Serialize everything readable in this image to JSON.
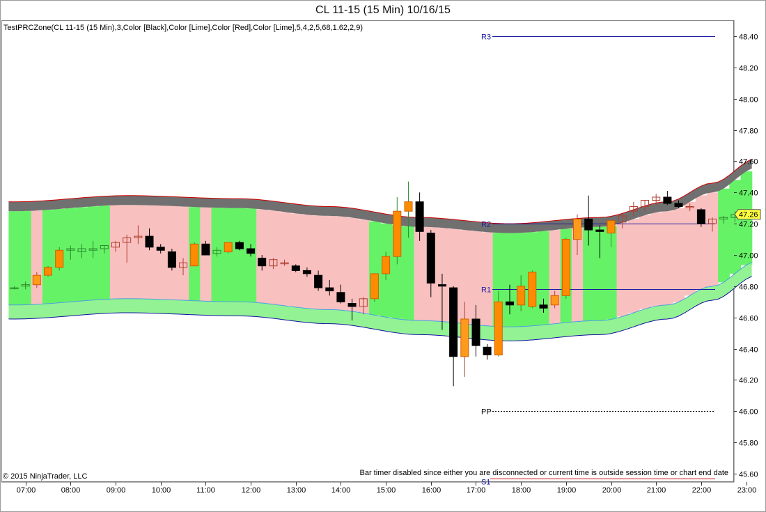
{
  "window": {
    "title": "CL 11-15 (15 Min)  10/16/15"
  },
  "indicator_label": "TestPRCZone(CL 11-15 (15 Min),3,Color [Black],Color [Lime],Color [Red],Color [Lime],5,4,2,5,68,1.62,2,9)",
  "copyright": "© 2015 NinjaTrader, LLC",
  "bar_timer_message": "Bar timer disabled since either you are disconnected or current time is outside session time or chart end date",
  "last_price_label": "47.26",
  "colors": {
    "band_pink": "#f9c0c0",
    "band_green": "#66f266",
    "band_gray": "#707070",
    "lower_band": "#93f293",
    "up_candle": "#ff8c00",
    "down_candle": "#000000",
    "level_line": "#1a1aa0"
  },
  "chart_data": {
    "type": "candlestick",
    "title": "CL 11-15 (15 Min)  10/16/15",
    "instrument": "CL 11-15",
    "interval": "15 Min",
    "date": "10/16/15",
    "x_ticks": [
      "07:00",
      "08:00",
      "09:00",
      "10:00",
      "11:00",
      "12:00",
      "13:00",
      "14:00",
      "15:00",
      "16:00",
      "17:00",
      "18:00",
      "19:00",
      "20:00",
      "21:00",
      "22:00",
      "23:00"
    ],
    "y_ticks": [
      "48.40",
      "48.20",
      "48.00",
      "47.80",
      "47.60",
      "47.40",
      "47.20",
      "47.00",
      "46.80",
      "46.60",
      "46.40",
      "46.20",
      "46.00",
      "45.80",
      "45.60"
    ],
    "ylim": [
      45.58,
      48.48
    ],
    "grid": false,
    "levels": [
      {
        "name": "R3",
        "value": 48.4,
        "style": "solid"
      },
      {
        "name": "R2",
        "value": 47.2,
        "style": "solid"
      },
      {
        "name": "R1",
        "value": 46.78,
        "style": "solid"
      },
      {
        "name": "PP",
        "value": 46.0,
        "style": "dotted"
      },
      {
        "name": "S1",
        "value": 45.57,
        "style": "solid"
      }
    ],
    "last_price": 47.26,
    "candles": [
      {
        "t": "06:45",
        "o": 46.79,
        "h": 46.8,
        "l": 46.78,
        "c": 46.79
      },
      {
        "t": "07:00",
        "o": 46.8,
        "h": 46.83,
        "l": 46.78,
        "c": 46.81
      },
      {
        "t": "07:15",
        "o": 46.81,
        "h": 46.89,
        "l": 46.79,
        "c": 46.87
      },
      {
        "t": "07:30",
        "o": 46.87,
        "h": 46.93,
        "l": 46.86,
        "c": 46.92
      },
      {
        "t": "07:45",
        "o": 46.92,
        "h": 47.05,
        "l": 46.9,
        "c": 47.03
      },
      {
        "t": "08:00",
        "o": 47.03,
        "h": 47.06,
        "l": 46.97,
        "c": 47.04
      },
      {
        "t": "08:15",
        "o": 47.02,
        "h": 47.07,
        "l": 46.98,
        "c": 47.04
      },
      {
        "t": "08:30",
        "o": 47.03,
        "h": 47.09,
        "l": 46.98,
        "c": 47.04
      },
      {
        "t": "08:45",
        "o": 47.04,
        "h": 47.06,
        "l": 47.01,
        "c": 47.06
      },
      {
        "t": "09:00",
        "o": 47.05,
        "h": 47.09,
        "l": 47.02,
        "c": 47.08
      },
      {
        "t": "09:15",
        "o": 47.08,
        "h": 47.13,
        "l": 46.95,
        "c": 47.11
      },
      {
        "t": "09:30",
        "o": 47.11,
        "h": 47.19,
        "l": 47.07,
        "c": 47.12
      },
      {
        "t": "09:45",
        "o": 47.12,
        "h": 47.17,
        "l": 47.03,
        "c": 47.05
      },
      {
        "t": "10:00",
        "o": 47.05,
        "h": 47.07,
        "l": 47.01,
        "c": 47.03
      },
      {
        "t": "10:15",
        "o": 47.02,
        "h": 47.04,
        "l": 46.9,
        "c": 46.92
      },
      {
        "t": "10:30",
        "o": 46.92,
        "h": 46.98,
        "l": 46.87,
        "c": 46.95
      },
      {
        "t": "10:45",
        "o": 46.93,
        "h": 47.08,
        "l": 46.93,
        "c": 47.07
      },
      {
        "t": "11:00",
        "o": 47.07,
        "h": 47.09,
        "l": 47.0,
        "c": 47.0
      },
      {
        "t": "11:15",
        "o": 47.01,
        "h": 47.05,
        "l": 46.99,
        "c": 47.03
      },
      {
        "t": "11:30",
        "o": 47.02,
        "h": 47.08,
        "l": 47.01,
        "c": 47.08
      },
      {
        "t": "11:45",
        "o": 47.08,
        "h": 47.09,
        "l": 47.03,
        "c": 47.04
      },
      {
        "t": "12:00",
        "o": 47.04,
        "h": 47.07,
        "l": 46.99,
        "c": 47.01
      },
      {
        "t": "12:15",
        "o": 46.98,
        "h": 47.0,
        "l": 46.9,
        "c": 46.93
      },
      {
        "t": "12:30",
        "o": 46.93,
        "h": 46.98,
        "l": 46.91,
        "c": 46.97
      },
      {
        "t": "12:45",
        "o": 46.95,
        "h": 46.97,
        "l": 46.93,
        "c": 46.95
      },
      {
        "t": "13:00",
        "o": 46.93,
        "h": 46.94,
        "l": 46.89,
        "c": 46.9
      },
      {
        "t": "13:15",
        "o": 46.9,
        "h": 46.92,
        "l": 46.86,
        "c": 46.88
      },
      {
        "t": "13:30",
        "o": 46.87,
        "h": 46.9,
        "l": 46.77,
        "c": 46.79
      },
      {
        "t": "13:45",
        "o": 46.79,
        "h": 46.84,
        "l": 46.74,
        "c": 46.77
      },
      {
        "t": "14:00",
        "o": 46.76,
        "h": 46.81,
        "l": 46.69,
        "c": 46.7
      },
      {
        "t": "14:15",
        "o": 46.69,
        "h": 46.72,
        "l": 46.58,
        "c": 46.67
      },
      {
        "t": "14:30",
        "o": 46.67,
        "h": 46.73,
        "l": 46.62,
        "c": 46.72
      },
      {
        "t": "14:45",
        "o": 46.72,
        "h": 46.88,
        "l": 46.7,
        "c": 46.88
      },
      {
        "t": "15:00",
        "o": 46.88,
        "h": 47.02,
        "l": 46.84,
        "c": 46.99
      },
      {
        "t": "15:15",
        "o": 46.99,
        "h": 47.37,
        "l": 46.94,
        "c": 47.28
      },
      {
        "t": "15:30",
        "o": 47.28,
        "h": 47.47,
        "l": 47.11,
        "c": 47.34
      },
      {
        "t": "15:45",
        "o": 47.34,
        "h": 47.4,
        "l": 47.09,
        "c": 47.15
      },
      {
        "t": "16:00",
        "o": 47.14,
        "h": 47.16,
        "l": 46.73,
        "c": 46.82
      },
      {
        "t": "16:15",
        "o": 46.81,
        "h": 46.88,
        "l": 46.52,
        "c": 46.8
      },
      {
        "t": "16:30",
        "o": 46.79,
        "h": 46.8,
        "l": 46.16,
        "c": 46.35
      },
      {
        "t": "16:45",
        "o": 46.35,
        "h": 46.7,
        "l": 46.22,
        "c": 46.59
      },
      {
        "t": "17:00",
        "o": 46.59,
        "h": 46.68,
        "l": 46.35,
        "c": 46.42
      },
      {
        "t": "17:15",
        "o": 46.41,
        "h": 46.43,
        "l": 46.33,
        "c": 46.36
      },
      {
        "t": "17:30",
        "o": 46.36,
        "h": 46.77,
        "l": 46.35,
        "c": 46.7
      },
      {
        "t": "17:45",
        "o": 46.7,
        "h": 46.81,
        "l": 46.62,
        "c": 46.68
      },
      {
        "t": "18:00",
        "o": 46.68,
        "h": 46.87,
        "l": 46.64,
        "c": 46.8
      },
      {
        "t": "18:15",
        "o": 46.67,
        "h": 46.9,
        "l": 46.66,
        "c": 46.89
      },
      {
        "t": "18:30",
        "o": 46.68,
        "h": 46.72,
        "l": 46.63,
        "c": 46.66
      },
      {
        "t": "18:45",
        "o": 46.68,
        "h": 46.77,
        "l": 46.66,
        "c": 46.74
      },
      {
        "t": "19:00",
        "o": 46.74,
        "h": 47.11,
        "l": 46.72,
        "c": 47.1
      },
      {
        "t": "19:15",
        "o": 47.1,
        "h": 47.26,
        "l": 47.0,
        "c": 47.23
      },
      {
        "t": "19:30",
        "o": 47.23,
        "h": 47.38,
        "l": 47.06,
        "c": 47.16
      },
      {
        "t": "19:45",
        "o": 47.16,
        "h": 47.19,
        "l": 46.98,
        "c": 47.15
      },
      {
        "t": "20:00",
        "o": 47.14,
        "h": 47.21,
        "l": 47.05,
        "c": 47.22
      },
      {
        "t": "20:15",
        "o": 47.21,
        "h": 47.26,
        "l": 47.17,
        "c": 47.25
      },
      {
        "t": "20:30",
        "o": 47.28,
        "h": 47.34,
        "l": 47.25,
        "c": 47.31
      },
      {
        "t": "20:45",
        "o": 47.31,
        "h": 47.35,
        "l": 47.28,
        "c": 47.35
      },
      {
        "t": "21:00",
        "o": 47.35,
        "h": 47.39,
        "l": 47.32,
        "c": 47.37
      },
      {
        "t": "21:15",
        "o": 47.37,
        "h": 47.41,
        "l": 47.32,
        "c": 47.33
      },
      {
        "t": "21:30",
        "o": 47.33,
        "h": 47.35,
        "l": 47.3,
        "c": 47.31
      },
      {
        "t": "21:45",
        "o": 47.31,
        "h": 47.33,
        "l": 47.28,
        "c": 47.31
      },
      {
        "t": "22:00",
        "o": 47.29,
        "h": 47.3,
        "l": 47.18,
        "c": 47.2
      },
      {
        "t": "22:15",
        "o": 47.2,
        "h": 47.24,
        "l": 47.15,
        "c": 47.23
      },
      {
        "t": "22:30",
        "o": 47.23,
        "h": 47.25,
        "l": 47.2,
        "c": 47.24
      },
      {
        "t": "22:45",
        "o": 47.24,
        "h": 47.28,
        "l": 47.21,
        "c": 47.26
      },
      {
        "t": "23:00",
        "o": 47.26,
        "h": 47.29,
        "l": 47.24,
        "c": 47.26
      }
    ],
    "zone_colors": [
      "g",
      "g",
      "p",
      "g",
      "g",
      "g",
      "g",
      "g",
      "g",
      "p",
      "p",
      "p",
      "p",
      "p",
      "p",
      "p",
      "g",
      "p",
      "g",
      "g",
      "g",
      "g",
      "p",
      "p",
      "p",
      "p",
      "p",
      "p",
      "p",
      "p",
      "p",
      "p",
      "g",
      "g",
      "g",
      "g",
      "p",
      "p",
      "p",
      "p",
      "p",
      "p",
      "p",
      "g",
      "g",
      "g",
      "g",
      "g",
      "p",
      "g",
      "p",
      "g",
      "g",
      "g",
      "p",
      "p",
      "p",
      "p",
      "p",
      "p",
      "p",
      "p",
      "p",
      "g",
      "g",
      "g"
    ]
  }
}
